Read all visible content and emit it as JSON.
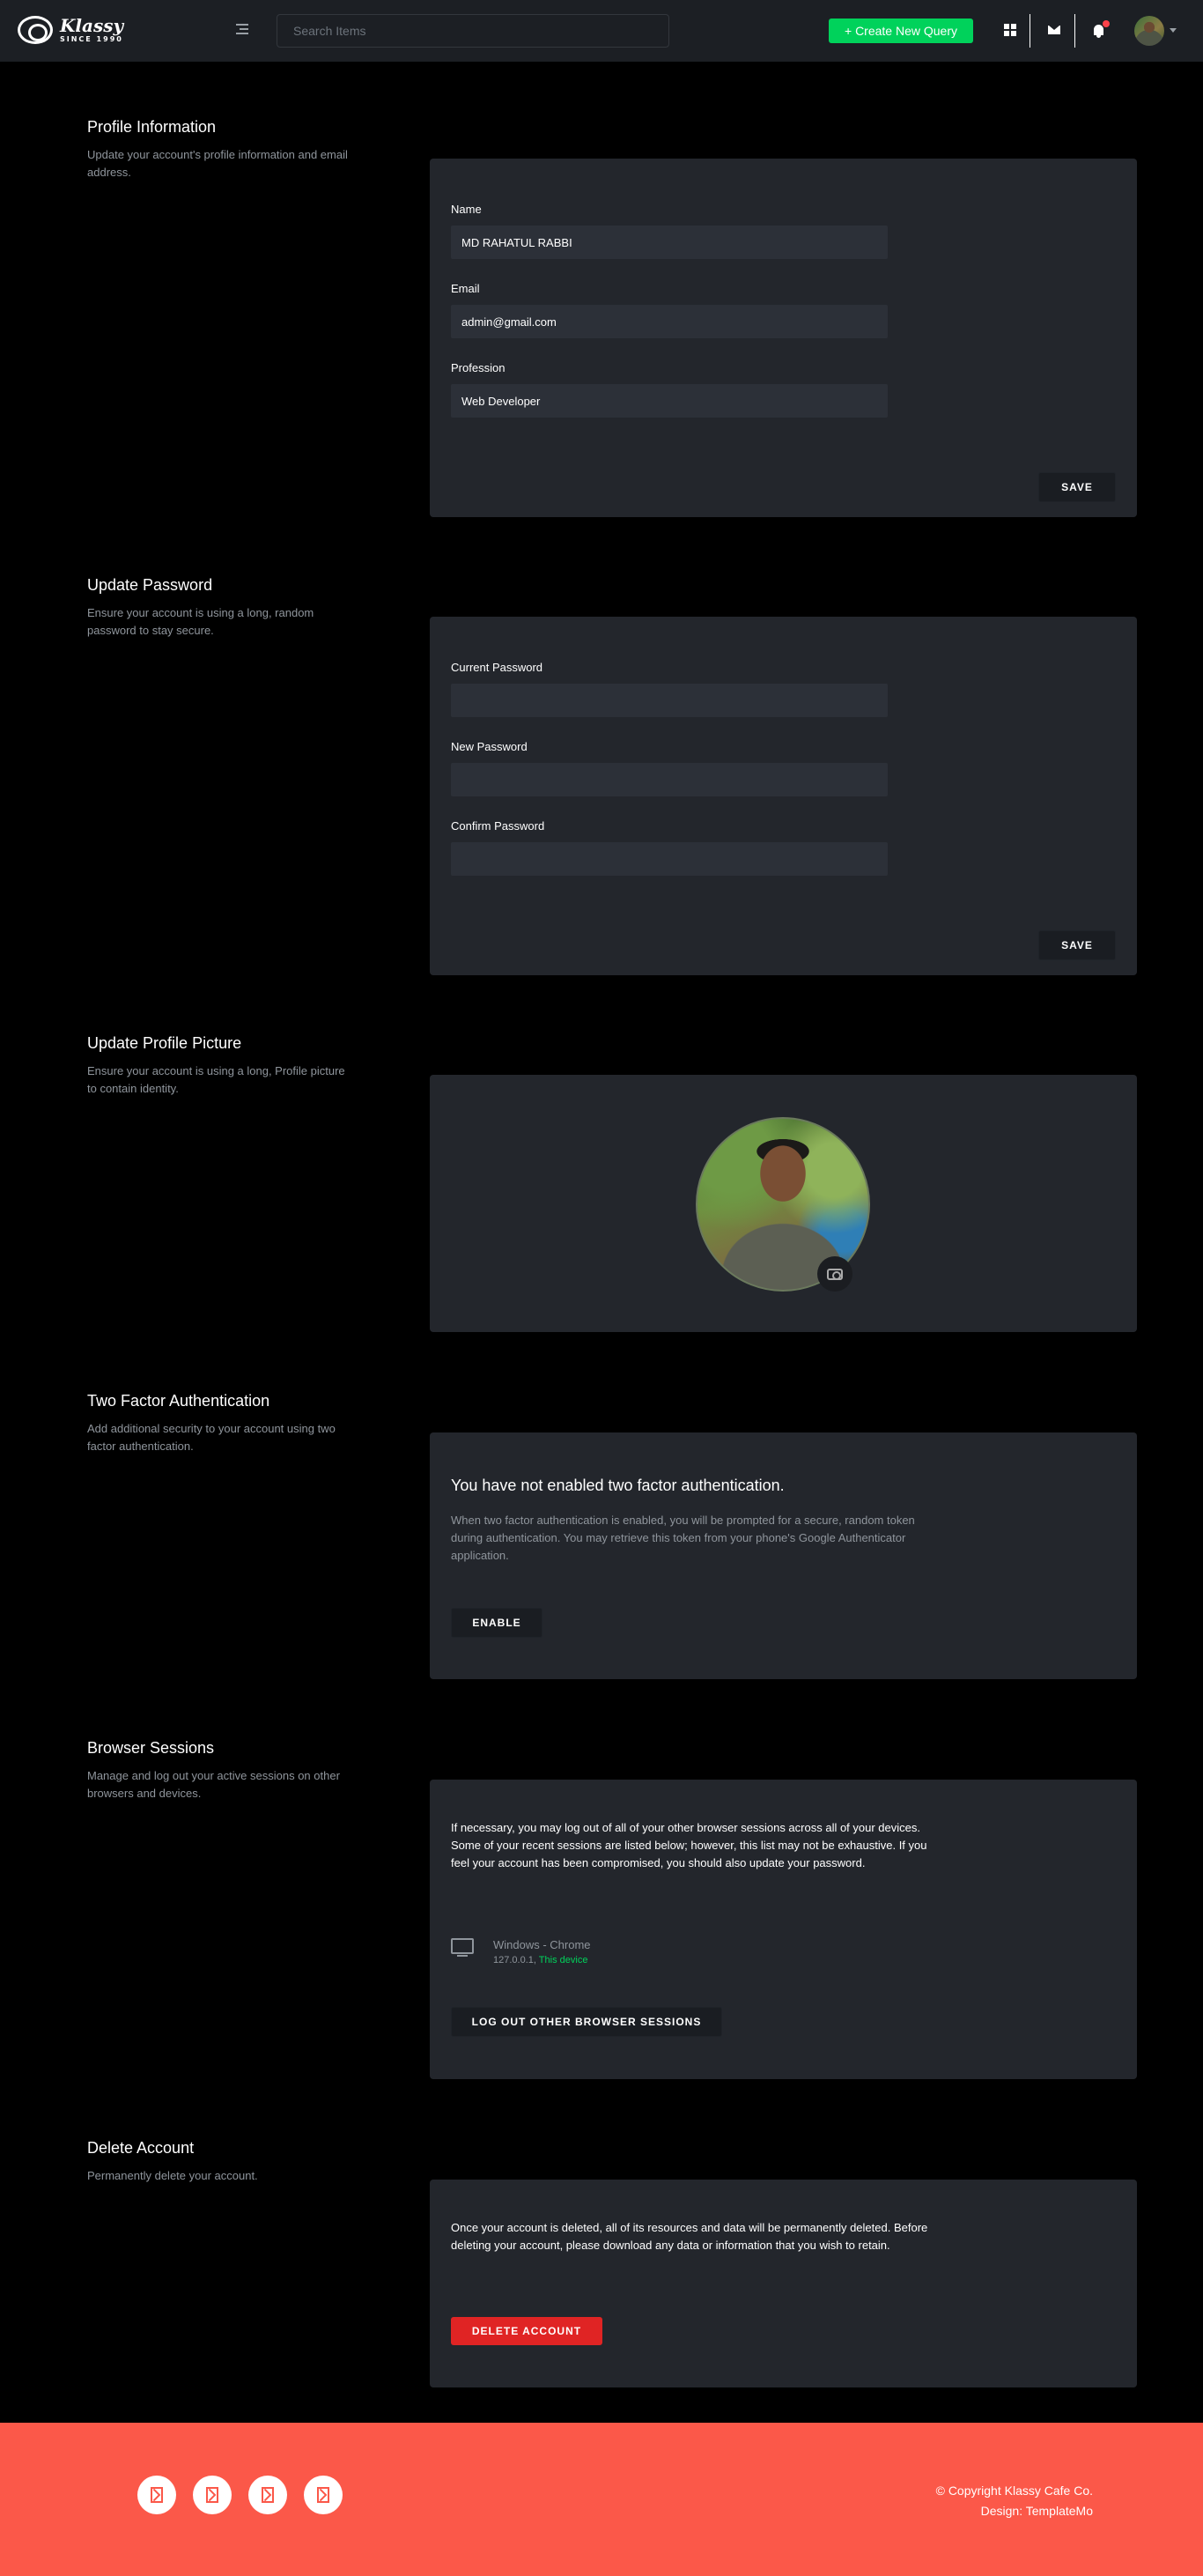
{
  "navbar": {
    "brand_name": "Klassy",
    "brand_since": "SINCE 1990",
    "search_placeholder": "Search Items",
    "create_label": "+ Create New Query"
  },
  "profile": {
    "title": "Profile Information",
    "desc": "Update your account's profile information and email address.",
    "name_label": "Name",
    "name_value": "MD RAHATUL RABBI",
    "email_label": "Email",
    "email_value": "admin@gmail.com",
    "profession_label": "Profession",
    "profession_value": "Web Developer",
    "save_label": "SAVE"
  },
  "password": {
    "title": "Update Password",
    "desc": "Ensure your account is using a long, random password to stay secure.",
    "current_label": "Current Password",
    "new_label": "New Password",
    "confirm_label": "Confirm Password",
    "save_label": "SAVE"
  },
  "picture": {
    "title": "Update Profile Picture",
    "desc": "Ensure your account is using a long, Profile picture to contain identity."
  },
  "two_factor": {
    "title": "Two Factor Authentication",
    "desc": "Add additional security to your account using two factor authentication.",
    "heading": "You have not enabled two factor authentication.",
    "text": "When two factor authentication is enabled, you will be prompted for a secure, random token during authentication. You may retrieve this token from your phone's Google Authenticator application.",
    "enable_label": "ENABLE"
  },
  "sessions": {
    "title": "Browser Sessions",
    "desc": "Manage and log out your active sessions on other browsers and devices.",
    "text": "If necessary, you may log out of all of your other browser sessions across all of your devices. Some of your recent sessions are listed below; however, this list may not be exhaustive. If you feel your account has been compromised, you should also update your password.",
    "device_name": "Windows - Chrome",
    "device_ip": "127.0.0.1,",
    "device_current": "This device",
    "logout_label": "LOG OUT OTHER BROWSER SESSIONS"
  },
  "delete": {
    "title": "Delete Account",
    "desc": "Permanently delete your account.",
    "text": "Once your account is deleted, all of its resources and data will be permanently deleted. Before deleting your account, please download any data or information that you wish to retain.",
    "button_label": "DELETE ACCOUNT"
  },
  "footer": {
    "copyright": "© Copyright Klassy Cafe Co.",
    "design": "Design: TemplateMo"
  },
  "colors": {
    "accent_green": "#00d25b",
    "danger_red": "#e02424",
    "footer_bg": "#fb5849",
    "notification_dot": "#fc424a"
  },
  "icons": [
    "menu-toggle-icon",
    "grid-icon",
    "mail-icon",
    "bell-icon",
    "camera-icon",
    "monitor-icon",
    "social-icon"
  ]
}
